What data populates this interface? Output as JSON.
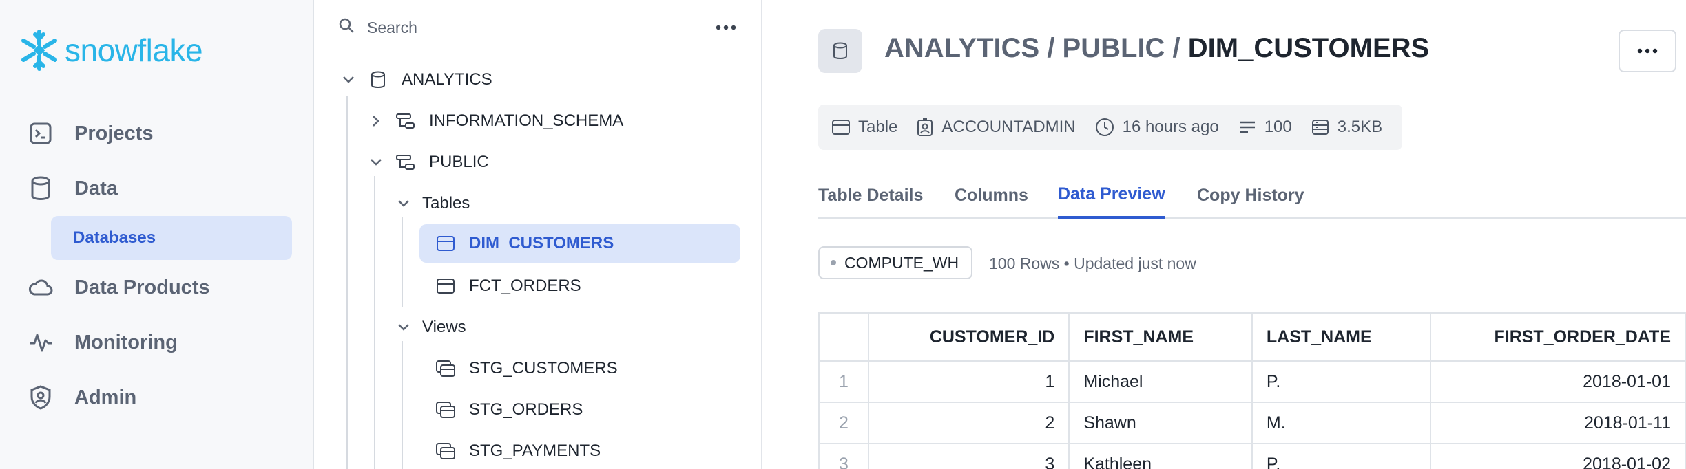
{
  "brand": {
    "wordmark": "snowflake",
    "color": "#29b5e8"
  },
  "nav": {
    "items": [
      {
        "label": "Projects",
        "icon": "terminal-icon"
      },
      {
        "label": "Data",
        "icon": "database-icon"
      },
      {
        "label": "Data Products",
        "icon": "cloud-icon"
      },
      {
        "label": "Monitoring",
        "icon": "activity-icon"
      },
      {
        "label": "Admin",
        "icon": "shield-icon"
      }
    ],
    "sub_active": "Databases"
  },
  "explorer": {
    "search_placeholder": "Search",
    "tree": {
      "database": "ANALYTICS",
      "schema_info": "INFORMATION_SCHEMA",
      "schema_public": "PUBLIC",
      "tables_group": "Tables",
      "tables": [
        "DIM_CUSTOMERS",
        "FCT_ORDERS"
      ],
      "views_group": "Views",
      "views": [
        "STG_CUSTOMERS",
        "STG_ORDERS",
        "STG_PAYMENTS"
      ]
    }
  },
  "header": {
    "crumb_prefix": "ANALYTICS / PUBLIC / ",
    "crumb_current": "DIM_CUSTOMERS"
  },
  "meta": {
    "type": "Table",
    "owner": "ACCOUNTADMIN",
    "updated": "16 hours ago",
    "rows": "100",
    "size": "3.5KB"
  },
  "tabs": [
    "Table Details",
    "Columns",
    "Data Preview",
    "Copy History"
  ],
  "active_tab": "Data Preview",
  "preview": {
    "warehouse": "COMPUTE_WH",
    "status": "100 Rows • Updated just now",
    "columns": [
      "CUSTOMER_ID",
      "FIRST_NAME",
      "LAST_NAME",
      "FIRST_ORDER_DATE"
    ],
    "rows": [
      [
        "1",
        "1",
        "Michael",
        "P.",
        "2018-01-01"
      ],
      [
        "2",
        "2",
        "Shawn",
        "M.",
        "2018-01-11"
      ],
      [
        "3",
        "3",
        "Kathleen",
        "P.",
        "2018-01-02"
      ]
    ]
  },
  "colors": {
    "accent": "#2f5bd0",
    "selected_bg": "#dbe5fa"
  }
}
